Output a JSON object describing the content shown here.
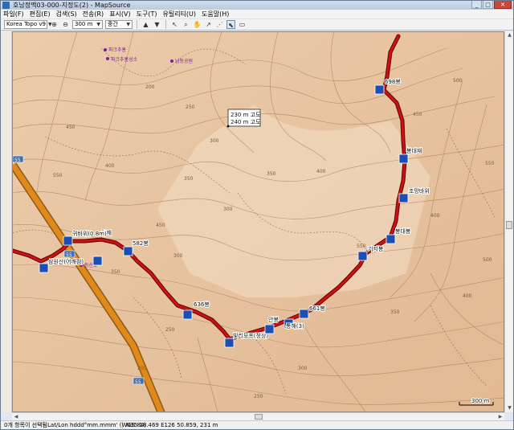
{
  "window": {
    "title": "호남정맥03-000-지정도(2) - MapSource",
    "buttons": [
      "_",
      "□",
      "✕"
    ]
  },
  "menu": {
    "items": [
      "파일(F)",
      "편집(E)",
      "검색(S)",
      "전송(R)",
      "표시(V)",
      "도구(T)",
      "유틸리티(U)",
      "도움말(H)"
    ]
  },
  "toolbar": {
    "map_product": "Korea Topo v9",
    "zoom_scale": "300 m",
    "detail": "중간",
    "icons": [
      "zoom-in-icon",
      "zoom-out-icon",
      "transfer-receive-icon",
      "transfer-send-icon",
      "selection-tool-icon",
      "zoom-tool-icon",
      "hand-tool-icon",
      "route-tool-icon",
      "track-tool-icon",
      "pointer-tool-icon",
      "distance-tool-icon"
    ]
  },
  "map": {
    "tooltip": [
      "230 m 고도",
      "240 m 고도"
    ],
    "scale_label": "300 m",
    "waypoints": [
      "698봉",
      "봉대재",
      "조망바위",
      "봉대봉",
      "기지봉",
      "661봉",
      "636봉",
      "582봉",
      "큰재",
      "귀바위(0.8m)",
      "삼원산(어깨점)",
      "빛리모프(정상)",
      "안봉",
      "통해(3)"
    ],
    "route_badges": [
      "55",
      "55",
      "55"
    ],
    "contour_labels": [
      "500",
      "550",
      "450",
      "400",
      "350",
      "300",
      "250",
      "200",
      "550",
      "450",
      "400",
      "350",
      "300",
      "550",
      "400",
      "450",
      "350",
      "300",
      "250",
      "200",
      "400",
      "350",
      "300",
      "250",
      "500"
    ],
    "poi_labels": [
      "파크추홍",
      "파크추홍성소",
      "남동공원",
      "등산로"
    ],
    "colors": {
      "terrain": "#e9c6a3",
      "contour": "#a07a58",
      "track": "#d11010",
      "road": "#e08a1e",
      "waypoint": "#1b4fb5"
    }
  },
  "statusbar": {
    "selection": "0개 항목이 선택됨",
    "format": "Lat/Lon hddd°mm.mmm' (WGS 84)",
    "coords": "N35 18.469 E126 50.859, 231 m"
  }
}
